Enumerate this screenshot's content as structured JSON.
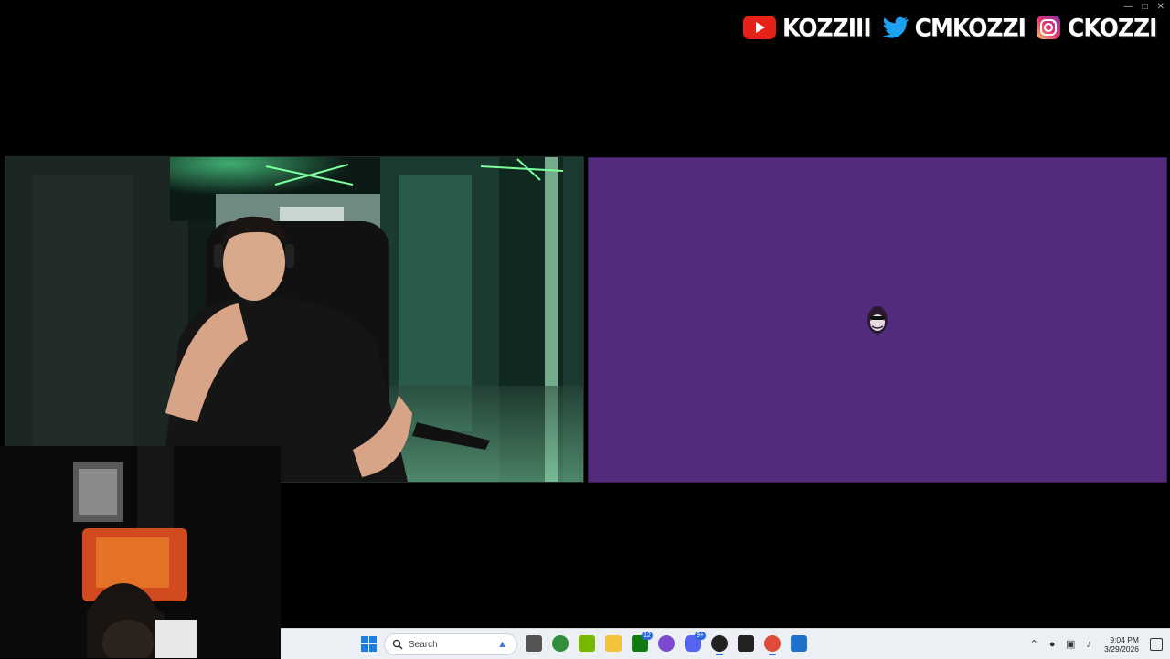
{
  "socials": [
    {
      "platform": "youtube",
      "icon": "youtube-icon",
      "label": "KOZZIII",
      "color": "#e62117"
    },
    {
      "platform": "twitter",
      "icon": "twitter-icon",
      "label": "CMKOZZI",
      "color": "#1da1f2"
    },
    {
      "platform": "instagram",
      "icon": "instagram-icon",
      "label": "CKOZZI",
      "color": "#c13584"
    }
  ],
  "window_controls": [
    "minimize-icon",
    "maximize-icon",
    "close-icon"
  ],
  "panels": {
    "main_cam": {
      "icon": "webcam-video"
    },
    "right_panel": {
      "background": "#532b7d",
      "icon": "face-emoji-icon"
    },
    "facecam": {
      "icon": "streamer-facecam"
    }
  },
  "taskbar": {
    "search_placeholder": "Search",
    "apps": [
      {
        "name": "task-view-icon",
        "color": "#555"
      },
      {
        "name": "xbox-icon",
        "color": "#2f8f3a"
      },
      {
        "name": "nvidia-icon",
        "color": "#76b900"
      },
      {
        "name": "file-explorer-icon",
        "color": "#f3c23c"
      },
      {
        "name": "xbox-app-icon",
        "color": "#107c10",
        "badge": "12"
      },
      {
        "name": "circle-app-icon",
        "color": "#7b4ad1"
      },
      {
        "name": "discord-icon",
        "color": "#5865f2",
        "badge": "9+"
      },
      {
        "name": "obs-icon",
        "color": "#222",
        "active": true
      },
      {
        "name": "epic-games-icon",
        "color": "#222"
      },
      {
        "name": "chrome-icon",
        "color": "#de4b39",
        "active": true
      },
      {
        "name": "store-icon",
        "color": "#1b74c9"
      }
    ],
    "clock": {
      "time": "9:04 PM",
      "date": "3/29/2026"
    }
  }
}
